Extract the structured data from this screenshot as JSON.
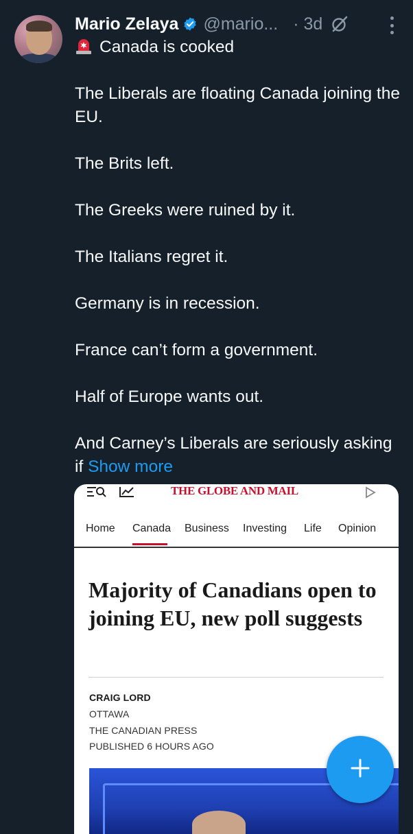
{
  "tweet": {
    "author_name": "Mario Zelaya",
    "handle": "@mario...",
    "time": "· 3d",
    "lines": [
      "Canada is cooked",
      "The Liberals are floating Canada joining the EU.",
      "The Brits left.",
      "The Greeks were ruined by it.",
      "The Italians regret it.",
      "Germany is in recession.",
      "France can’t form a government.",
      "Half of Europe wants out.",
      "And Carney’s Liberals are seriously asking if"
    ],
    "show_more": "Show more",
    "icons": {
      "first_line": "siren-icon",
      "verified": "verified-badge-icon",
      "grok": "grok-icon",
      "more": "more-vertical-icon"
    }
  },
  "card": {
    "logo": "THE GLOBE AND MAIL",
    "nav": [
      "Home",
      "Canada",
      "Business",
      "Investing",
      "Life",
      "Opinion"
    ],
    "active_nav": "Canada",
    "headline": "Majority of Canadians open to joining EU, new poll suggests",
    "author": "CRAIG LORD",
    "location": "OTTAWA",
    "source": "THE CANADIAN PRESS",
    "published": "PUBLISHED 6 HOURS AGO"
  },
  "fab": {
    "icon": "plus-icon"
  },
  "colors": {
    "background": "#15202b",
    "link": "#1d9bf0",
    "muted": "#8b98a5",
    "globe_red": "#c8102e"
  }
}
